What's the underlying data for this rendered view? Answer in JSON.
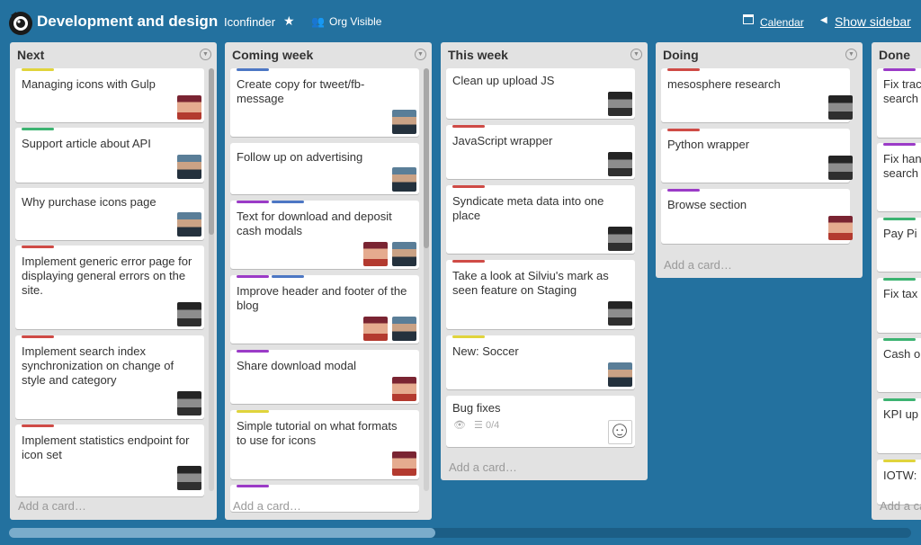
{
  "header": {
    "board_title": "Development and design",
    "org_name": "Iconfinder",
    "star_glyph": "★",
    "visibility": "Org Visible",
    "calendar_label": "Calendar",
    "sidebar_label": "Show sidebar"
  },
  "colors": {
    "board_bg": "#23719f",
    "label_yellow": "#e0d43c",
    "label_green": "#3cb371",
    "label_red": "#cf4b46",
    "label_purple": "#9b3bc7",
    "label_blue": "#4d77c4"
  },
  "lists": [
    {
      "name": "Next",
      "add_card": "Add a card…",
      "cards": [
        {
          "title": "Managing icons with Gulp",
          "labels": [
            "yellow"
          ],
          "avatars": [
            "avatar-a"
          ]
        },
        {
          "title": "Support article about API",
          "labels": [
            "green"
          ],
          "avatars": [
            "avatar-b"
          ]
        },
        {
          "title": "Why purchase icons page",
          "labels": [],
          "avatars": [
            "avatar-b"
          ]
        },
        {
          "title": "Implement generic error page for displaying general errors on the site.",
          "labels": [
            "red"
          ],
          "avatars": [
            "avatar-c"
          ]
        },
        {
          "title": "Implement search index synchronization on change of style and category",
          "labels": [
            "red"
          ],
          "avatars": [
            "avatar-c"
          ]
        },
        {
          "title": "Implement statistics endpoint for icon set",
          "labels": [
            "red"
          ],
          "avatars": [
            "avatar-c"
          ]
        }
      ]
    },
    {
      "name": "Coming week",
      "add_card": "Add a card…",
      "cards": [
        {
          "title": "Create copy for tweet/fb-message",
          "labels": [
            "blue"
          ],
          "avatars": [
            "avatar-b"
          ]
        },
        {
          "title": "Follow up on advertising",
          "labels": [],
          "avatars": [
            "avatar-b"
          ]
        },
        {
          "title": "Text for download and deposit cash modals",
          "labels": [
            "purple",
            "blue"
          ],
          "avatars": [
            "avatar-a",
            "avatar-b"
          ]
        },
        {
          "title": "Improve header and footer of the blog",
          "labels": [
            "purple",
            "blue"
          ],
          "avatars": [
            "avatar-a",
            "avatar-b"
          ]
        },
        {
          "title": "Share download modal",
          "labels": [
            "purple"
          ],
          "avatars": [
            "avatar-a"
          ]
        },
        {
          "title": "Simple tutorial on what formats to use for icons",
          "labels": [
            "yellow"
          ],
          "avatars": [
            "avatar-a"
          ]
        },
        {
          "title": "",
          "labels": [
            "purple"
          ],
          "avatars": []
        }
      ]
    },
    {
      "name": "This week",
      "add_card": "Add a card…",
      "cards": [
        {
          "title": "Clean up upload JS",
          "labels": [],
          "avatars": [
            "avatar-c"
          ]
        },
        {
          "title": "JavaScript wrapper",
          "labels": [
            "red"
          ],
          "avatars": [
            "avatar-c"
          ]
        },
        {
          "title": "Syndicate meta data into one place",
          "labels": [
            "red"
          ],
          "avatars": [
            "avatar-c"
          ]
        },
        {
          "title": "Take a look at Silviu's mark as seen feature on Staging",
          "labels": [
            "red"
          ],
          "avatars": [
            "avatar-c"
          ]
        },
        {
          "title": "New: Soccer",
          "labels": [
            "yellow"
          ],
          "avatars": [
            "avatar-b"
          ]
        },
        {
          "title": "Bug fixes",
          "labels": [],
          "avatars": [
            "avatar-d"
          ],
          "checklist": "0/4"
        }
      ]
    },
    {
      "name": "Doing",
      "add_card": "Add a card…",
      "cards": [
        {
          "title": "mesosphere research",
          "labels": [
            "red"
          ],
          "avatars": [
            "avatar-c"
          ]
        },
        {
          "title": "Python wrapper",
          "labels": [
            "red"
          ],
          "avatars": [
            "avatar-c"
          ]
        },
        {
          "title": "Browse section",
          "labels": [
            "purple"
          ],
          "avatars": [
            "avatar-a"
          ]
        }
      ]
    },
    {
      "name": "Done",
      "add_card": "Add a card…",
      "cards": [
        {
          "title": "Fix trac search",
          "labels": [
            "purple"
          ]
        },
        {
          "title": "Fix han search",
          "labels": [
            "purple"
          ]
        },
        {
          "title": "Pay Pi",
          "labels": [
            "green"
          ]
        },
        {
          "title": "Fix tax",
          "labels": [
            "green"
          ]
        },
        {
          "title": "Cash o",
          "labels": [
            "green"
          ]
        },
        {
          "title": "KPI up",
          "labels": [
            "green"
          ]
        },
        {
          "title": "IOTW:",
          "labels": [
            "yellow"
          ]
        }
      ]
    }
  ]
}
